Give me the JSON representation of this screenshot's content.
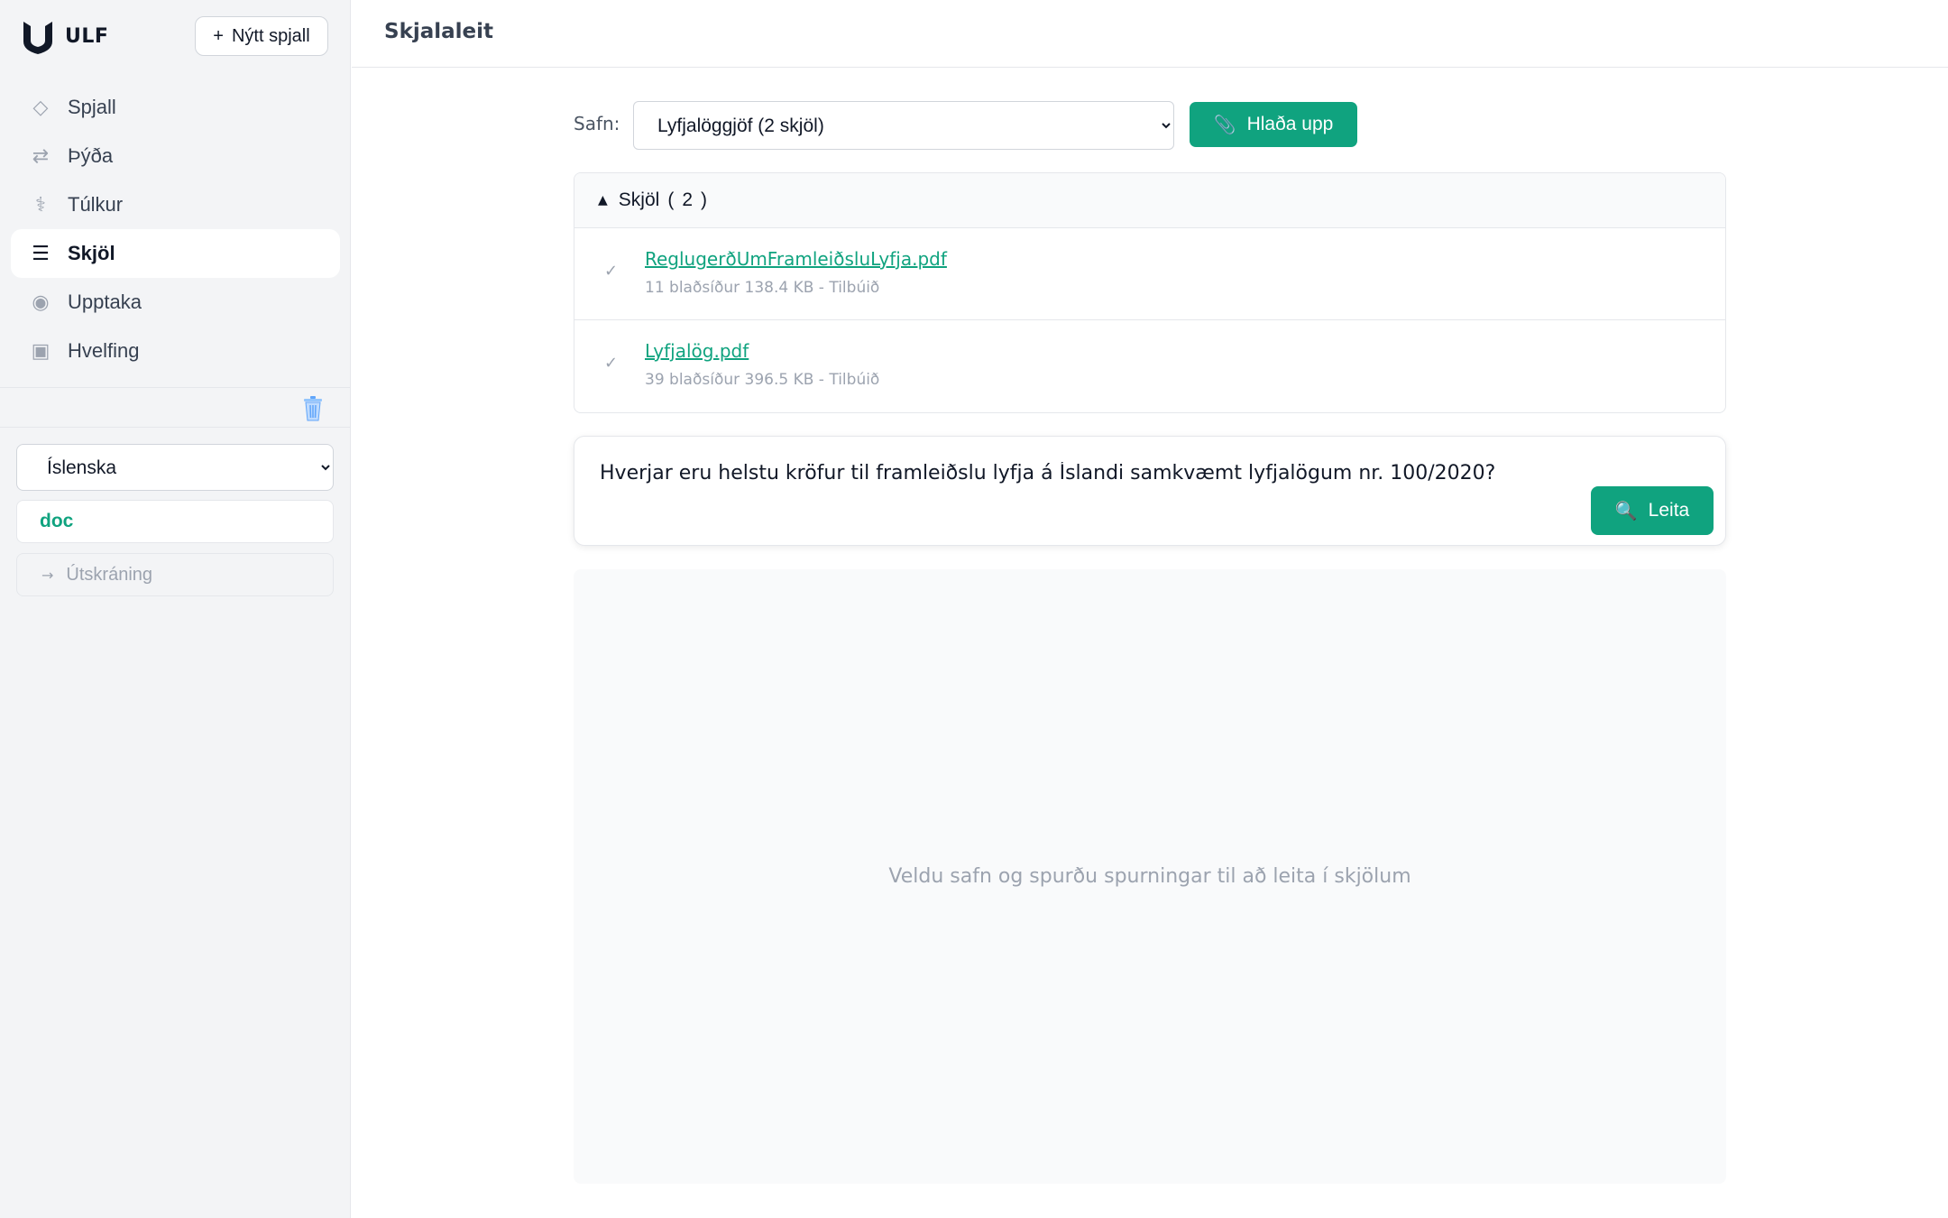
{
  "sidebar": {
    "brand": "ULF",
    "new_chat_label": "Nýtt spjall",
    "nav": [
      {
        "label": "Spjall",
        "icon": "diamond-icon",
        "glyph": "◇",
        "active": false
      },
      {
        "label": "Þýða",
        "icon": "swap-arrows-icon",
        "glyph": "⇄",
        "active": false
      },
      {
        "label": "Túlkur",
        "icon": "interpreter-icon",
        "glyph": "⚕",
        "active": false
      },
      {
        "label": "Skjöl",
        "icon": "list-icon",
        "glyph": "☰",
        "active": true
      },
      {
        "label": "Upptaka",
        "icon": "record-icon",
        "glyph": "◉",
        "active": false
      },
      {
        "label": "Hvelfing",
        "icon": "vault-icon",
        "glyph": "▣",
        "active": false
      }
    ],
    "language": "Íslenska",
    "mode": "doc",
    "logout_label": "Útskráning"
  },
  "header": {
    "title": "Skjalaleit"
  },
  "collection": {
    "label": "Safn:",
    "selected": "Lyfjalöggjöf (2 skjöl)",
    "upload_label": "Hlaða upp"
  },
  "documents": {
    "header_label": "Skjöl",
    "count": "2",
    "items": [
      {
        "name": "ReglugerðUmFramleiðsluLyfja.pdf",
        "meta": "11 blaðsíður 138.4 KB - Tilbúið"
      },
      {
        "name": "Lyfjalög.pdf",
        "meta": "39 blaðsíður 396.5 KB - Tilbúið"
      }
    ]
  },
  "query": {
    "value": "Hverjar eru helstu kröfur til framleiðslu lyfja á Íslandi samkvæmt lyfjalögum nr. 100/2020?",
    "search_label": "Leita"
  },
  "results": {
    "empty_message": "Veldu safn og spurðu spurningar til að leita í skjölum"
  },
  "colors": {
    "accent": "#10a37f",
    "sidebar_bg": "#f3f4f6",
    "muted_text": "#9ca3af"
  }
}
